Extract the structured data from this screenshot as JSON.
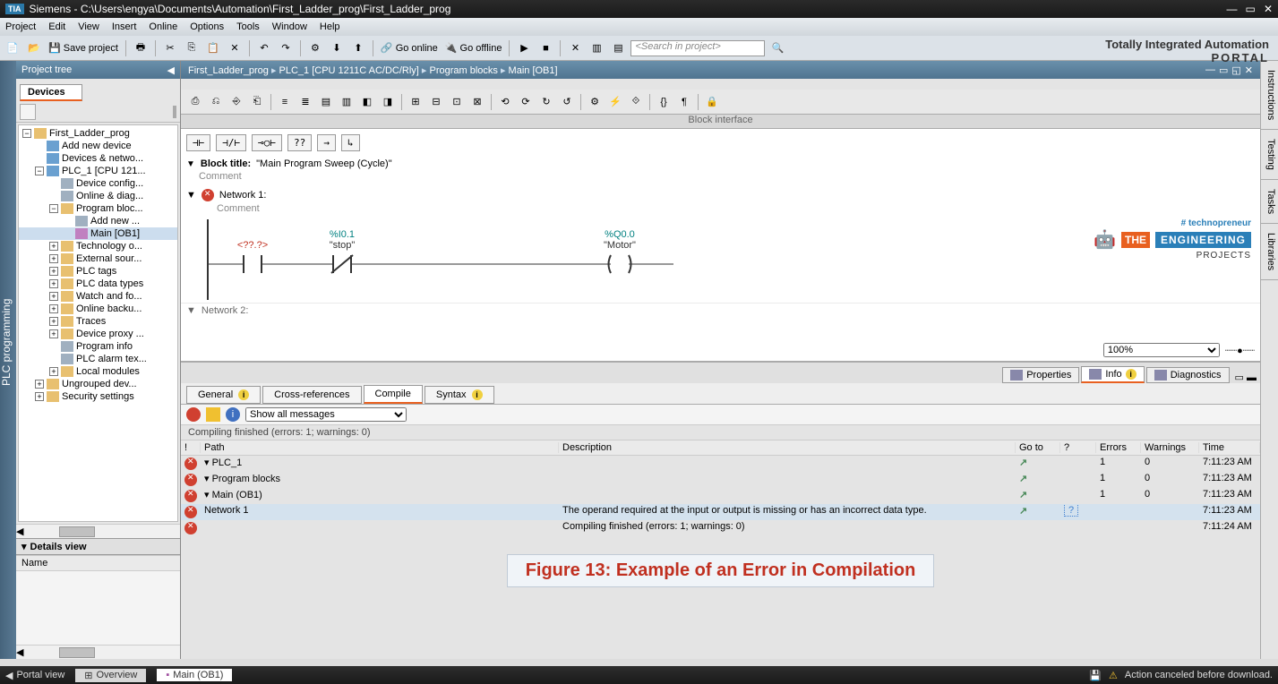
{
  "title": "Siemens - C:\\Users\\engya\\Documents\\Automation\\First_Ladder_prog\\First_Ladder_prog",
  "menu": [
    "Project",
    "Edit",
    "View",
    "Insert",
    "Online",
    "Options",
    "Tools",
    "Window",
    "Help"
  ],
  "tia": {
    "l1": "Totally Integrated Automation",
    "l2": "PORTAL"
  },
  "toolbar": {
    "save": "Save project",
    "goonline": "Go online",
    "gooffline": "Go offline",
    "search_ph": "<Search in project>"
  },
  "projtree": {
    "header": "Project tree",
    "devices_tab": "Devices",
    "nodes": [
      {
        "ind": 0,
        "exp": "▾",
        "ico": "ico-folder",
        "label": "First_Ladder_prog"
      },
      {
        "ind": 1,
        "exp": "",
        "ico": "ico-dev",
        "label": "Add new device"
      },
      {
        "ind": 1,
        "exp": "",
        "ico": "ico-dev",
        "label": "Devices & netwo..."
      },
      {
        "ind": 1,
        "exp": "▾",
        "ico": "ico-dev",
        "label": "PLC_1 [CPU 121..."
      },
      {
        "ind": 2,
        "exp": "",
        "ico": "ico-gen",
        "label": "Device config..."
      },
      {
        "ind": 2,
        "exp": "",
        "ico": "ico-gen",
        "label": "Online & diag..."
      },
      {
        "ind": 2,
        "exp": "▾",
        "ico": "ico-folder",
        "label": "Program bloc..."
      },
      {
        "ind": 3,
        "exp": "",
        "ico": "ico-gen",
        "label": "Add new ..."
      },
      {
        "ind": 3,
        "exp": "",
        "ico": "ico-blk",
        "label": "Main [OB1]",
        "sel": true
      },
      {
        "ind": 2,
        "exp": "▸",
        "ico": "ico-folder",
        "label": "Technology o..."
      },
      {
        "ind": 2,
        "exp": "▸",
        "ico": "ico-folder",
        "label": "External sour..."
      },
      {
        "ind": 2,
        "exp": "▸",
        "ico": "ico-folder",
        "label": "PLC tags"
      },
      {
        "ind": 2,
        "exp": "▸",
        "ico": "ico-folder",
        "label": "PLC data types"
      },
      {
        "ind": 2,
        "exp": "▸",
        "ico": "ico-folder",
        "label": "Watch and fo..."
      },
      {
        "ind": 2,
        "exp": "▸",
        "ico": "ico-folder",
        "label": "Online backu..."
      },
      {
        "ind": 2,
        "exp": "▸",
        "ico": "ico-folder",
        "label": "Traces"
      },
      {
        "ind": 2,
        "exp": "▸",
        "ico": "ico-folder",
        "label": "Device proxy ..."
      },
      {
        "ind": 2,
        "exp": "",
        "ico": "ico-gen",
        "label": "Program info"
      },
      {
        "ind": 2,
        "exp": "",
        "ico": "ico-gen",
        "label": "PLC alarm tex..."
      },
      {
        "ind": 2,
        "exp": "▸",
        "ico": "ico-folder",
        "label": "Local modules"
      },
      {
        "ind": 1,
        "exp": "▸",
        "ico": "ico-folder",
        "label": "Ungrouped dev..."
      },
      {
        "ind": 1,
        "exp": "▸",
        "ico": "ico-folder",
        "label": "Security settings"
      }
    ],
    "details": "Details view",
    "col_name": "Name"
  },
  "leftstrip": "PLC programming",
  "breadcrumb": [
    "First_Ladder_prog",
    "PLC_1 [CPU 1211C AC/DC/Rly]",
    "Program blocks",
    "Main [OB1]"
  ],
  "block_iface": "Block interface",
  "ladder": {
    "tools": [
      "⊣⊢",
      "⊣/⊢",
      "⊸○⊢",
      "??",
      "→",
      "↳"
    ],
    "block_title_label": "Block title:",
    "block_title_val": "\"Main Program Sweep (Cycle)\"",
    "comment": "Comment",
    "net1": "Network 1:",
    "net1_comment": "Comment",
    "tag1": "<??.?>",
    "tag2_addr": "%I0.1",
    "tag2_name": "\"stop\"",
    "tag3_addr": "%Q0.0",
    "tag3_name": "\"Motor\"",
    "net2": "Network 2:",
    "zoom": "100%"
  },
  "watermark": {
    "tag": "# technopreneur",
    "the": "THE",
    "eng": "ENGINEERING",
    "prj": "PROJECTS"
  },
  "info_outer_tabs": [
    {
      "label": "Properties",
      "ico": "⚙"
    },
    {
      "label": "Info",
      "ico": "ℹ",
      "sel": true
    },
    {
      "label": "Diagnostics",
      "ico": "⚡"
    }
  ],
  "info_inner_tabs": [
    {
      "label": "General",
      "info": true
    },
    {
      "label": "Cross-references"
    },
    {
      "label": "Compile",
      "sel": true
    },
    {
      "label": "Syntax",
      "info": true
    }
  ],
  "filter": {
    "dropdown": "Show all messages"
  },
  "compile_status": "Compiling finished (errors: 1; warnings: 0)",
  "msg_headers": [
    "!",
    "Path",
    "Description",
    "Go to",
    "?",
    "Errors",
    "Warnings",
    "Time"
  ],
  "messages": [
    {
      "err": true,
      "path": "▾  PLC_1",
      "desc": "",
      "goto": "↗",
      "q": "",
      "errors": "1",
      "warnings": "0",
      "time": "7:11:23 AM"
    },
    {
      "err": true,
      "path": "      ▾  Program blocks",
      "desc": "",
      "goto": "↗",
      "q": "",
      "errors": "1",
      "warnings": "0",
      "time": "7:11:23 AM"
    },
    {
      "err": true,
      "path": "            ▾  Main (OB1)",
      "desc": "",
      "goto": "↗",
      "q": "",
      "errors": "1",
      "warnings": "0",
      "time": "7:11:23 AM"
    },
    {
      "err": true,
      "path": "                  Network 1",
      "desc": "The operand required at the input or output is missing or has an incorrect data type.",
      "goto": "↗",
      "q": "?",
      "errors": "",
      "warnings": "",
      "time": "7:11:23 AM",
      "sel": true
    },
    {
      "err": true,
      "path": "",
      "desc": "Compiling finished (errors: 1; warnings: 0)",
      "goto": "",
      "q": "",
      "errors": "",
      "warnings": "",
      "time": "7:11:24 AM"
    }
  ],
  "figure": "Figure 13: Example of an Error in Compilation",
  "righttabs": [
    "Instructions",
    "Testing",
    "Tasks",
    "Libraries"
  ],
  "status": {
    "portal": "Portal view",
    "overview": "Overview",
    "main": "Main (OB1)",
    "msg": "Action canceled before download."
  }
}
